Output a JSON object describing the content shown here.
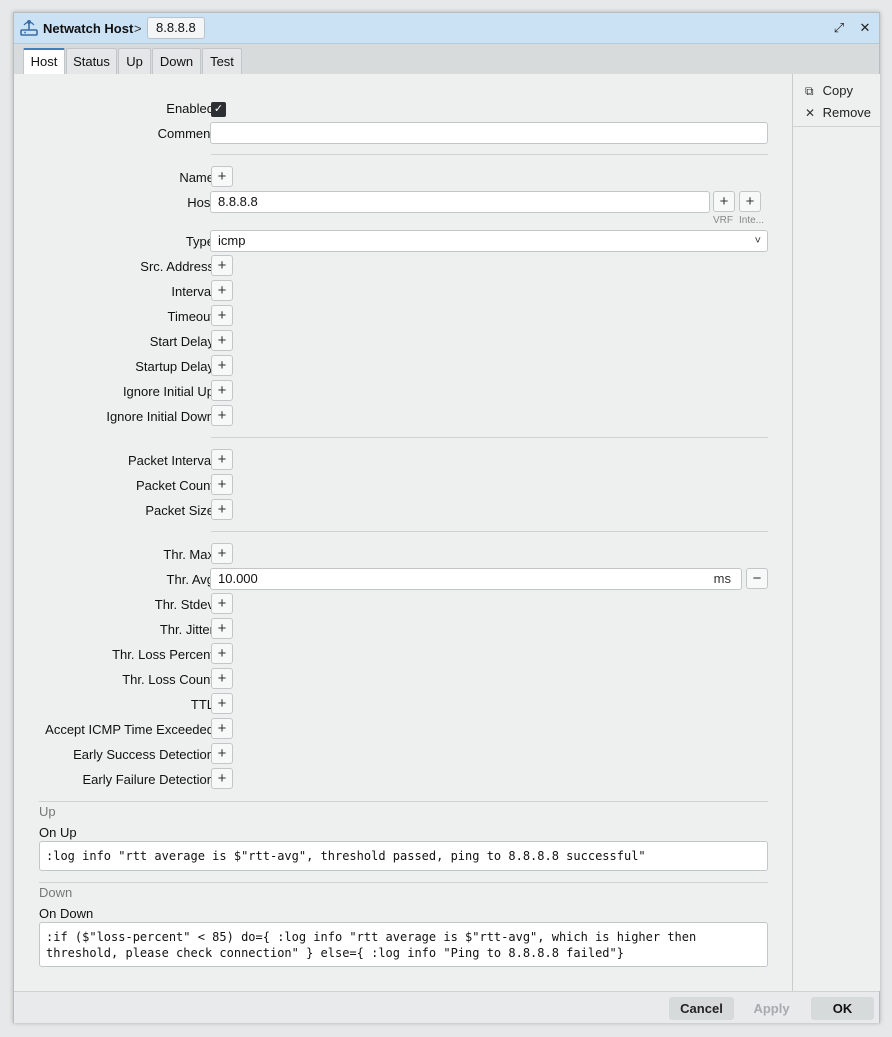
{
  "window": {
    "title": "Netwatch Host",
    "separator": ">",
    "badge": "8.8.8.8",
    "restore_glyph": "⤢",
    "close_glyph": "✕"
  },
  "tabs": [
    {
      "label": "Host"
    },
    {
      "label": "Status"
    },
    {
      "label": "Up"
    },
    {
      "label": "Down"
    },
    {
      "label": "Test"
    }
  ],
  "side": {
    "copy_label": "Copy",
    "remove_label": "Remove"
  },
  "form": {
    "enabled_label": "Enabled",
    "enabled": true,
    "comment_label": "Comment",
    "comment_value": "",
    "name_label": "Name",
    "host_label": "Host",
    "host_value": "8.8.8.8",
    "vrf_caption": "VRF",
    "inte_caption": "Inte...",
    "type_label": "Type",
    "type_value": "icmp",
    "src_address_label": "Src. Address",
    "interval_label": "Interval",
    "timeout_label": "Timeout",
    "start_delay_label": "Start Delay",
    "startup_delay_label": "Startup Delay",
    "ignore_initial_up_label": "Ignore Initial Up",
    "ignore_initial_down_label": "Ignore Initial Down",
    "packet_interval_label": "Packet Interval",
    "packet_count_label": "Packet Count",
    "packet_size_label": "Packet Size",
    "thr_max_label": "Thr. Max",
    "thr_avg_label": "Thr. Avg",
    "thr_avg_value": "10.000",
    "thr_avg_unit": "ms",
    "thr_stdev_label": "Thr. Stdev",
    "thr_jitter_label": "Thr. Jitter",
    "thr_loss_percent_label": "Thr. Loss Percent",
    "thr_loss_count_label": "Thr. Loss Count",
    "ttl_label": "TTL",
    "accept_icmp_label": "Accept ICMP Time Exceeded",
    "early_success_label": "Early Success Detection",
    "early_failure_label": "Early Failure Detection",
    "plus_glyph": "+",
    "minus_glyph": "−",
    "dropdown_glyph": "˅"
  },
  "up": {
    "section_label": "Up",
    "on_up_label": "On Up",
    "on_up_script": ":log info \"rtt average is $\"rtt-avg\", threshold passed, ping to 8.8.8.8 successful\""
  },
  "down": {
    "section_label": "Down",
    "on_down_label": "On Down",
    "on_down_script": ":if ($\"loss-percent\" < 85) do={ :log info \"rtt average is $\"rtt-avg\", which is higher then\nthreshold, please check connection\" } else={ :log info \"Ping to 8.8.8.8 failed\"}"
  },
  "footer": {
    "cancel_label": "Cancel",
    "apply_label": "Apply",
    "ok_label": "OK"
  }
}
